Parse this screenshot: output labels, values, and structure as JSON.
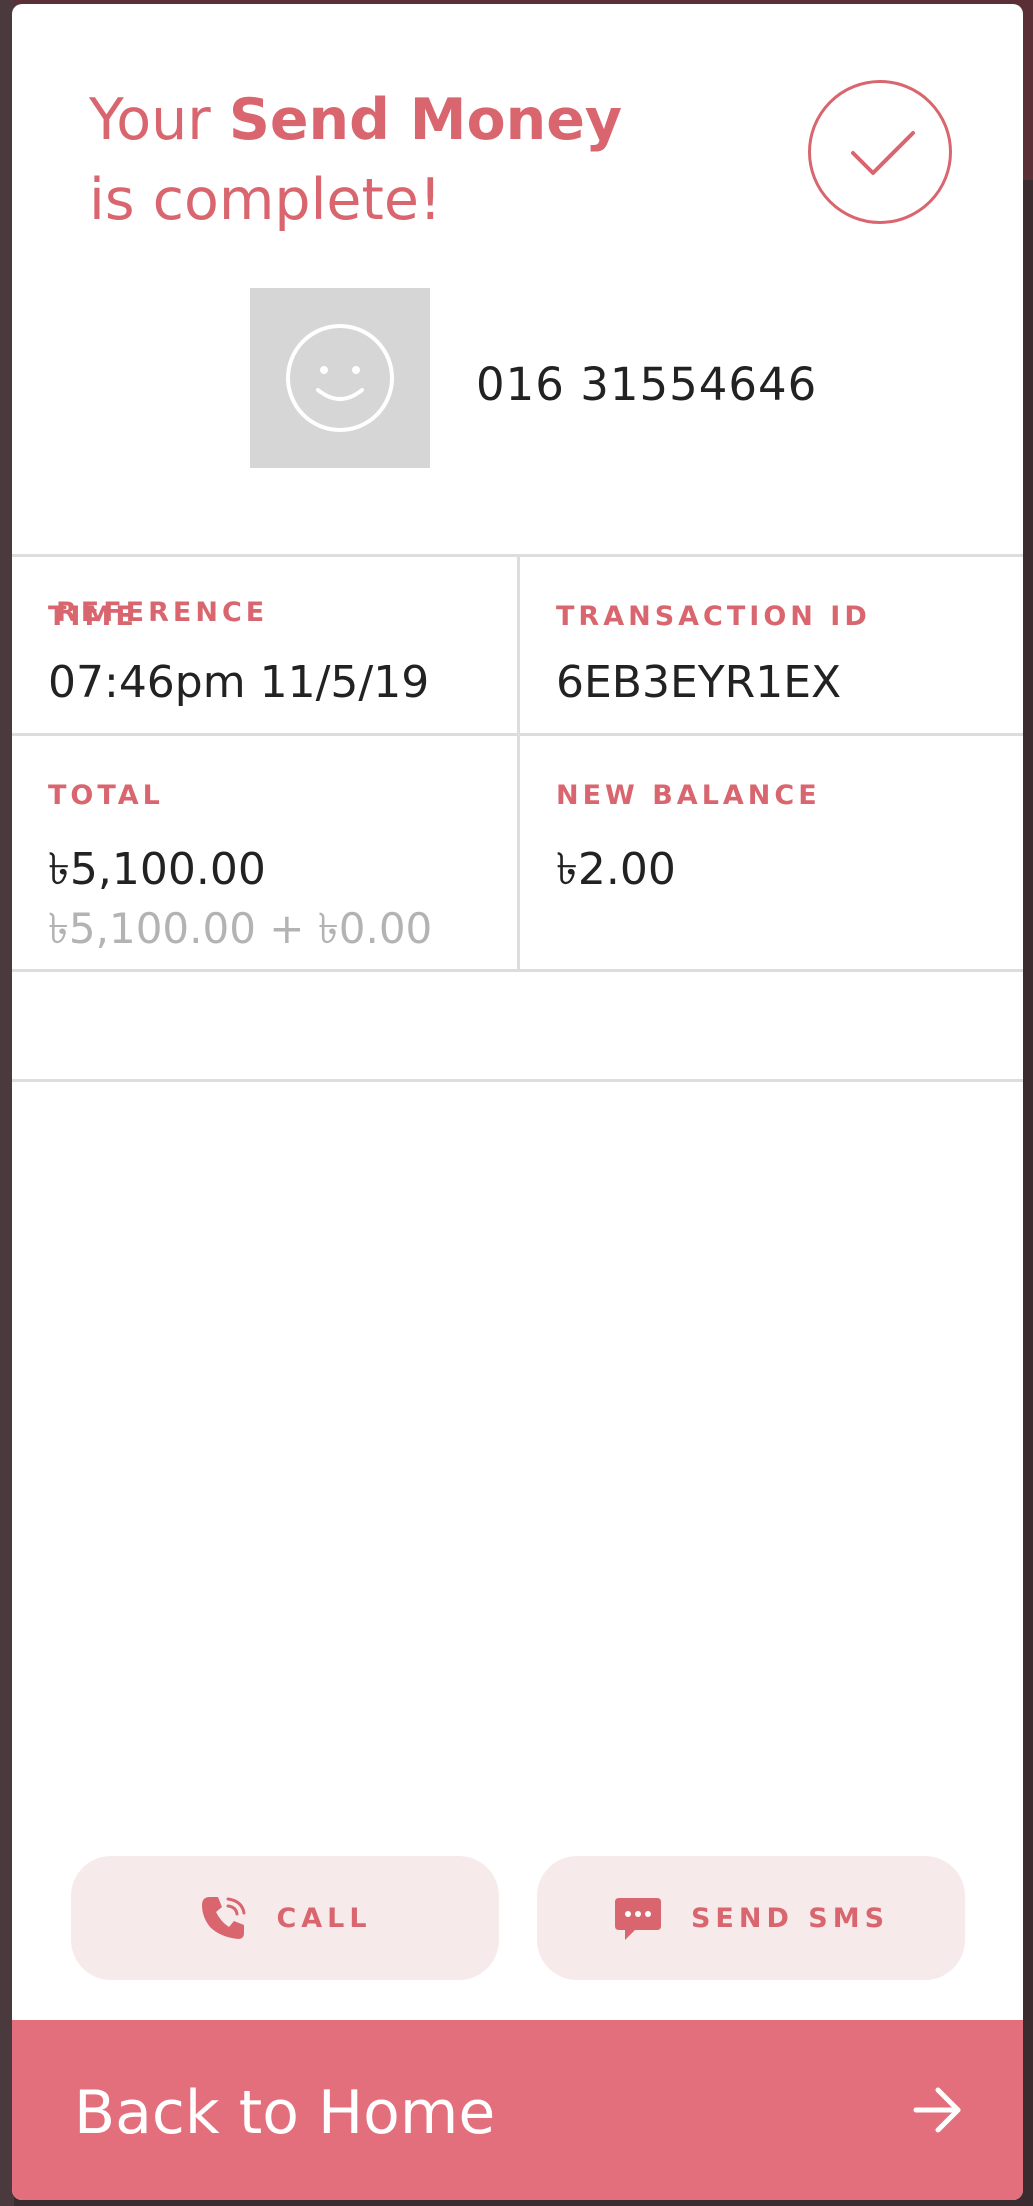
{
  "colors": {
    "accent": "#d9666f",
    "home_bar": "#e46f7c",
    "pill_bg": "#f7eaeb"
  },
  "header": {
    "title_prefix": "Your ",
    "title_bold": "Send Money",
    "title_suffix": "is complete!",
    "status_icon": "check-circle-icon"
  },
  "recipient": {
    "avatar_icon": "smiley-icon",
    "phone": "016 31554646"
  },
  "details": {
    "time": {
      "label": "TIME",
      "value": "07:46pm 11/5/19"
    },
    "transaction_id": {
      "label": "TRANSACTION ID",
      "value": "6EB3EYR1EX"
    },
    "total": {
      "label": "TOTAL",
      "value": "৳5,100.00",
      "breakdown": "৳5,100.00 + ৳0.00"
    },
    "new_balance": {
      "label": "NEW BALANCE",
      "value": "৳2.00"
    },
    "reference": {
      "label": "REFERENCE"
    }
  },
  "actions": {
    "call": {
      "label": "CALL",
      "icon": "phone-icon"
    },
    "sms": {
      "label": "SEND SMS",
      "icon": "message-icon"
    }
  },
  "footer": {
    "home_label": "Back to Home",
    "icon": "arrow-right-icon"
  }
}
